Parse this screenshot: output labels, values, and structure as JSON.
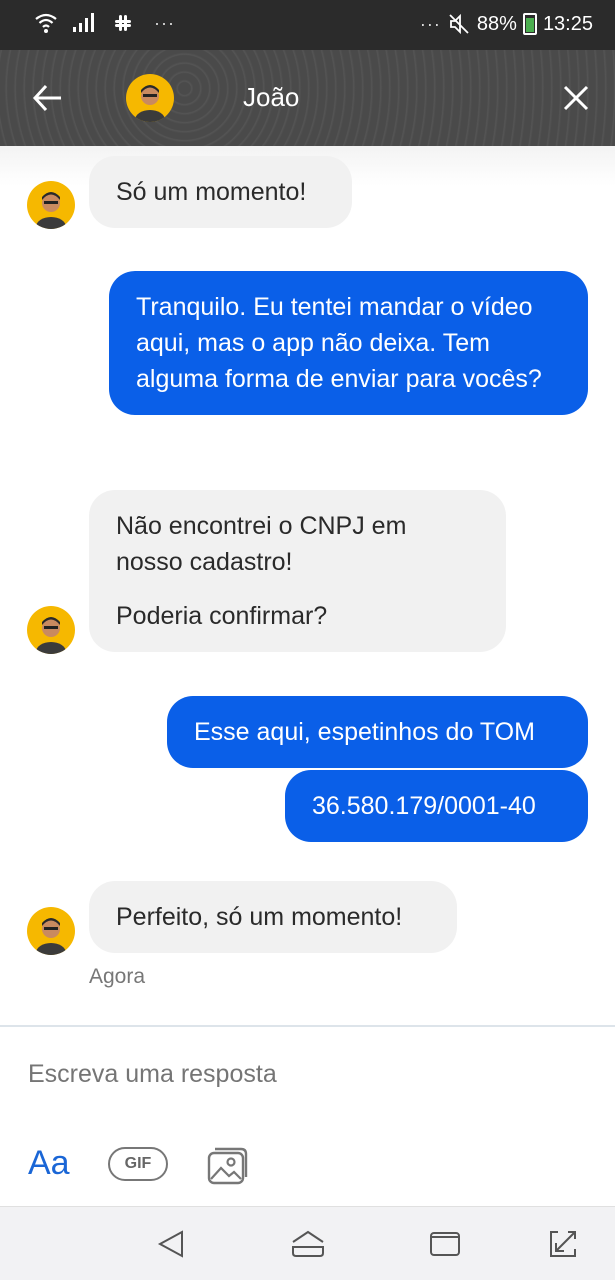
{
  "status_bar": {
    "dots_left": "···",
    "dots_right": "···",
    "battery": "88%",
    "time": "13:25"
  },
  "header": {
    "contact_name": "João"
  },
  "messages": [
    {
      "from": "agent",
      "paragraphs": [
        "Só um momento!"
      ]
    },
    {
      "from": "user",
      "paragraphs": [
        "Tranquilo. Eu tentei mandar o vídeo aqui, mas o app não deixa. Tem alguma forma de enviar para vocês?"
      ]
    },
    {
      "from": "agent",
      "paragraphs": [
        "Não encontrei o CNPJ em nosso cadastro!",
        "Poderia confirmar?"
      ]
    },
    {
      "from": "user",
      "paragraphs": [
        "Esse aqui, espetinhos do TOM"
      ]
    },
    {
      "from": "user",
      "paragraphs": [
        "36.580.179/0001-40"
      ]
    },
    {
      "from": "agent",
      "paragraphs": [
        "Perfeito, só um momento!"
      ]
    }
  ],
  "last_message_time": "Agora",
  "composer": {
    "placeholder": "Escreva uma resposta",
    "aa_label": "Aa",
    "gif_label": "GIF"
  },
  "colors": {
    "outgoing_bubble": "#0a5fe8",
    "incoming_bubble": "#f1f1f1",
    "avatar_background": "#f6b800"
  },
  "icons": {
    "back": "arrow-left-icon",
    "close": "close-icon",
    "image": "image-gallery-icon",
    "nav": [
      "nav-back-icon",
      "nav-home-icon",
      "nav-recents-icon",
      "nav-expand-icon"
    ]
  }
}
